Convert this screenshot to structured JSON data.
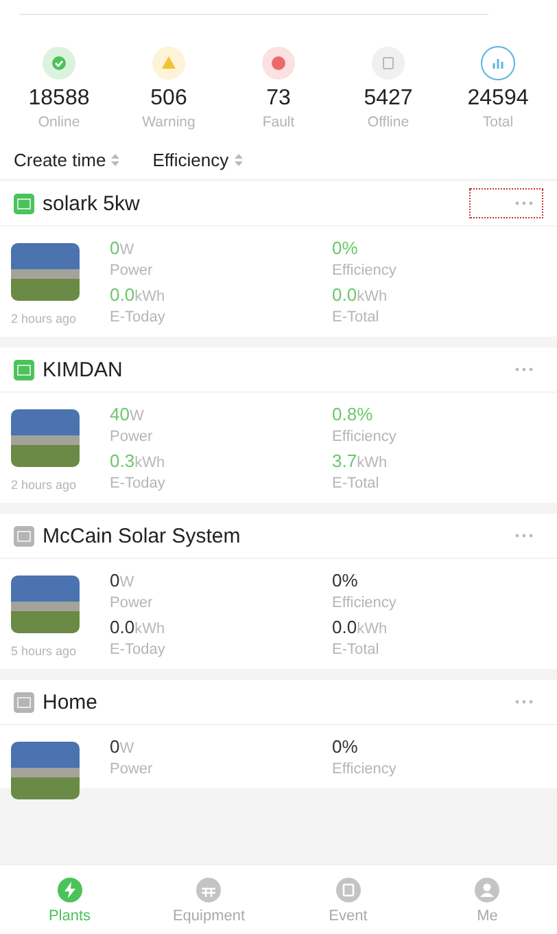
{
  "stats": [
    {
      "kind": "online",
      "value": "18588",
      "label": "Online"
    },
    {
      "kind": "warning",
      "value": "506",
      "label": "Warning"
    },
    {
      "kind": "fault",
      "value": "73",
      "label": "Fault"
    },
    {
      "kind": "offline",
      "value": "5427",
      "label": "Offline"
    },
    {
      "kind": "total",
      "value": "24594",
      "label": "Total"
    }
  ],
  "sort": [
    {
      "label": "Create time"
    },
    {
      "label": "Efficiency"
    }
  ],
  "plants": [
    {
      "name": "solark 5kw",
      "online": true,
      "highlighted": true,
      "updated": "2 hours ago",
      "metrics": [
        {
          "value": "0",
          "unit": "W",
          "label": "Power"
        },
        {
          "value": "0%",
          "label": "Efficiency"
        },
        {
          "value": "0.0",
          "unit": "kWh",
          "label": "E-Today"
        },
        {
          "value": "0.0",
          "unit": "kWh",
          "label": "E-Total"
        }
      ]
    },
    {
      "name": "KIMDAN",
      "online": true,
      "highlighted": false,
      "updated": "2 hours ago",
      "metrics": [
        {
          "value": "40",
          "unit": "W",
          "label": "Power"
        },
        {
          "value": "0.8%",
          "label": "Efficiency"
        },
        {
          "value": "0.3",
          "unit": "kWh",
          "label": "E-Today"
        },
        {
          "value": "3.7",
          "unit": "kWh",
          "label": "E-Total"
        }
      ]
    },
    {
      "name": "McCain Solar System",
      "online": false,
      "highlighted": false,
      "updated": "5 hours ago",
      "metrics": [
        {
          "value": "0",
          "unit": "W",
          "label": "Power"
        },
        {
          "value": "0%",
          "label": "Efficiency"
        },
        {
          "value": "0.0",
          "unit": "kWh",
          "label": "E-Today"
        },
        {
          "value": "0.0",
          "unit": "kWh",
          "label": "E-Total"
        }
      ]
    },
    {
      "name": "Home",
      "online": false,
      "highlighted": false,
      "metrics": [
        {
          "value": "0",
          "unit": "W",
          "label": "Power"
        },
        {
          "value": "0%",
          "label": "Efficiency"
        }
      ]
    }
  ],
  "nav": [
    {
      "kind": "plants",
      "label": "Plants",
      "selected": true
    },
    {
      "kind": "equipment",
      "label": "Equipment",
      "selected": false
    },
    {
      "kind": "event",
      "label": "Event",
      "selected": false
    },
    {
      "kind": "me",
      "label": "Me",
      "selected": false
    }
  ]
}
